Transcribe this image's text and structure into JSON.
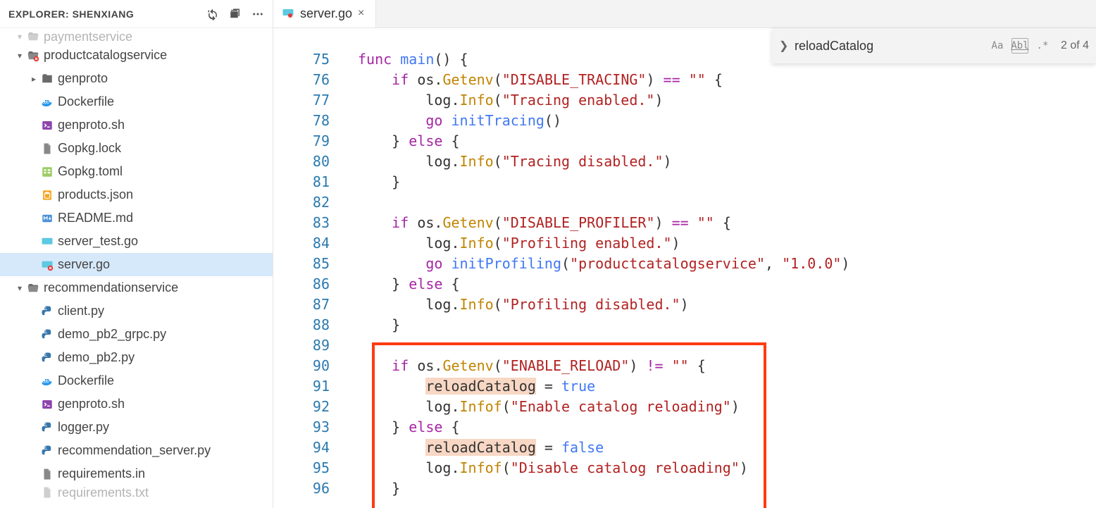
{
  "explorer": {
    "title": "EXPLORER: SHENXIANG",
    "actions": {
      "refresh": "refresh-icon",
      "collapse": "collapse-all-icon",
      "more": "more-icon"
    }
  },
  "tree": [
    {
      "depth": 1,
      "kind": "folder",
      "expanded": true,
      "truncated": true,
      "label": "paymentservice"
    },
    {
      "depth": 1,
      "kind": "folder",
      "expanded": true,
      "label": "productcatalogservice",
      "badge": "error"
    },
    {
      "depth": 2,
      "kind": "folder",
      "expanded": false,
      "label": "genproto"
    },
    {
      "depth": 2,
      "kind": "docker",
      "label": "Dockerfile"
    },
    {
      "depth": 2,
      "kind": "sh",
      "label": "genproto.sh"
    },
    {
      "depth": 2,
      "kind": "file",
      "label": "Gopkg.lock"
    },
    {
      "depth": 2,
      "kind": "toml",
      "label": "Gopkg.toml"
    },
    {
      "depth": 2,
      "kind": "json",
      "label": "products.json"
    },
    {
      "depth": 2,
      "kind": "md",
      "label": "README.md"
    },
    {
      "depth": 2,
      "kind": "go",
      "label": "server_test.go"
    },
    {
      "depth": 2,
      "kind": "go",
      "label": "server.go",
      "selected": true,
      "badge": "error"
    },
    {
      "depth": 1,
      "kind": "folder",
      "expanded": true,
      "label": "recommendationservice"
    },
    {
      "depth": 2,
      "kind": "py",
      "label": "client.py"
    },
    {
      "depth": 2,
      "kind": "py",
      "label": "demo_pb2_grpc.py"
    },
    {
      "depth": 2,
      "kind": "py",
      "label": "demo_pb2.py"
    },
    {
      "depth": 2,
      "kind": "docker",
      "label": "Dockerfile"
    },
    {
      "depth": 2,
      "kind": "sh",
      "label": "genproto.sh"
    },
    {
      "depth": 2,
      "kind": "py",
      "label": "logger.py"
    },
    {
      "depth": 2,
      "kind": "py",
      "label": "recommendation_server.py"
    },
    {
      "depth": 2,
      "kind": "file",
      "label": "requirements.in"
    },
    {
      "depth": 2,
      "kind": "file",
      "label": "requirements.txt",
      "truncated": true
    }
  ],
  "tab": {
    "filename": "server.go"
  },
  "find": {
    "query": "reloadCatalog",
    "caseLabel": "Aa",
    "wordLabel": "Abl",
    "regexLabel": ".*",
    "count": "2 of 4"
  },
  "lines": {
    "start": 75,
    "end": 96
  },
  "code": {
    "l75": {
      "t0": "func",
      "t1": "main",
      "t2": "() {"
    },
    "l76": {
      "t0": "if",
      "t1": "os",
      "t2": "Getenv",
      "t3": "\"DISABLE_TRACING\"",
      "t4": "==",
      "t5": "\"\"",
      "t6": " {"
    },
    "l77": {
      "t0": "log",
      "t1": "Info",
      "t2": "\"Tracing enabled.\""
    },
    "l78": {
      "t0": "go",
      "t1": "initTracing",
      "t2": "()"
    },
    "l79": {
      "t0": "}",
      "t1": "else",
      "t2": "{"
    },
    "l80": {
      "t0": "log",
      "t1": "Info",
      "t2": "\"Tracing disabled.\""
    },
    "l81": {
      "t0": "}"
    },
    "l82": {},
    "l83": {
      "t0": "if",
      "t1": "os",
      "t2": "Getenv",
      "t3": "\"DISABLE_PROFILER\"",
      "t4": "==",
      "t5": "\"\"",
      "t6": " {"
    },
    "l84": {
      "t0": "log",
      "t1": "Info",
      "t2": "\"Profiling enabled.\""
    },
    "l85": {
      "t0": "go",
      "t1": "initProfiling",
      "t2": "\"productcatalogservice\"",
      "t3": "\"1.0.0\""
    },
    "l86": {
      "t0": "}",
      "t1": "else",
      "t2": "{"
    },
    "l87": {
      "t0": "log",
      "t1": "Info",
      "t2": "\"Profiling disabled.\""
    },
    "l88": {
      "t0": "}"
    },
    "l89": {},
    "l90": {
      "t0": "if",
      "t1": "os",
      "t2": "Getenv",
      "t3": "\"ENABLE_RELOAD\"",
      "t4": "!=",
      "t5": "\"\"",
      "t6": " {"
    },
    "l91": {
      "t0": "reloadCatalog",
      "t1": " = ",
      "t2": "true"
    },
    "l92": {
      "t0": "log",
      "t1": "Infof",
      "t2": "\"Enable catalog reloading\""
    },
    "l93": {
      "t0": "}",
      "t1": "else",
      "t2": "{"
    },
    "l94": {
      "t0": "reloadCatalog",
      "t1": " = ",
      "t2": "false"
    },
    "l95": {
      "t0": "log",
      "t1": "Infof",
      "t2": "\"Disable catalog reloading\""
    },
    "l96": {
      "t0": "}"
    }
  }
}
